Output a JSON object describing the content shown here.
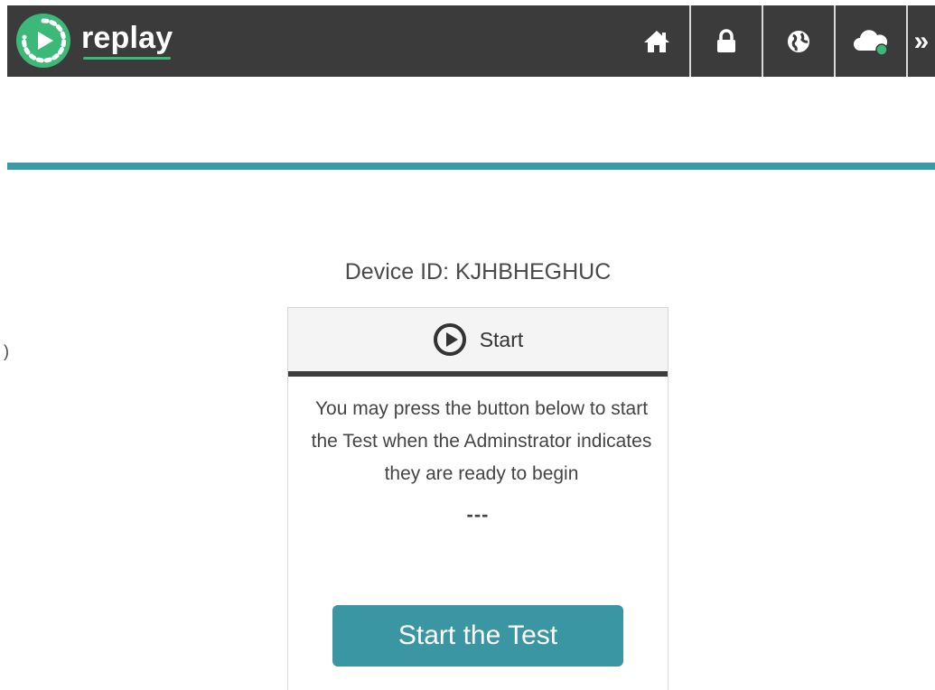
{
  "navbar": {
    "brand_name": "replay",
    "icons": [
      "home-icon",
      "lock-icon",
      "globe-icon",
      "cloud-status-icon"
    ],
    "more_label": "»",
    "colors": {
      "background": "#3b3b3b",
      "brand_accent": "#3cb878",
      "status_dot": "#3cb878"
    }
  },
  "device": {
    "label": "Device ID: KJHBHEGHUC"
  },
  "card": {
    "header_title": "Start",
    "message": "You may press the button below to start the Test when the Adminstrator indicates they are ready to begin",
    "status": "---",
    "button_label": "Start the Test",
    "colors": {
      "accent": "#3a96a2",
      "header_border": "#3d3d3d"
    }
  },
  "divider": {
    "color": "#3a9aa6"
  }
}
